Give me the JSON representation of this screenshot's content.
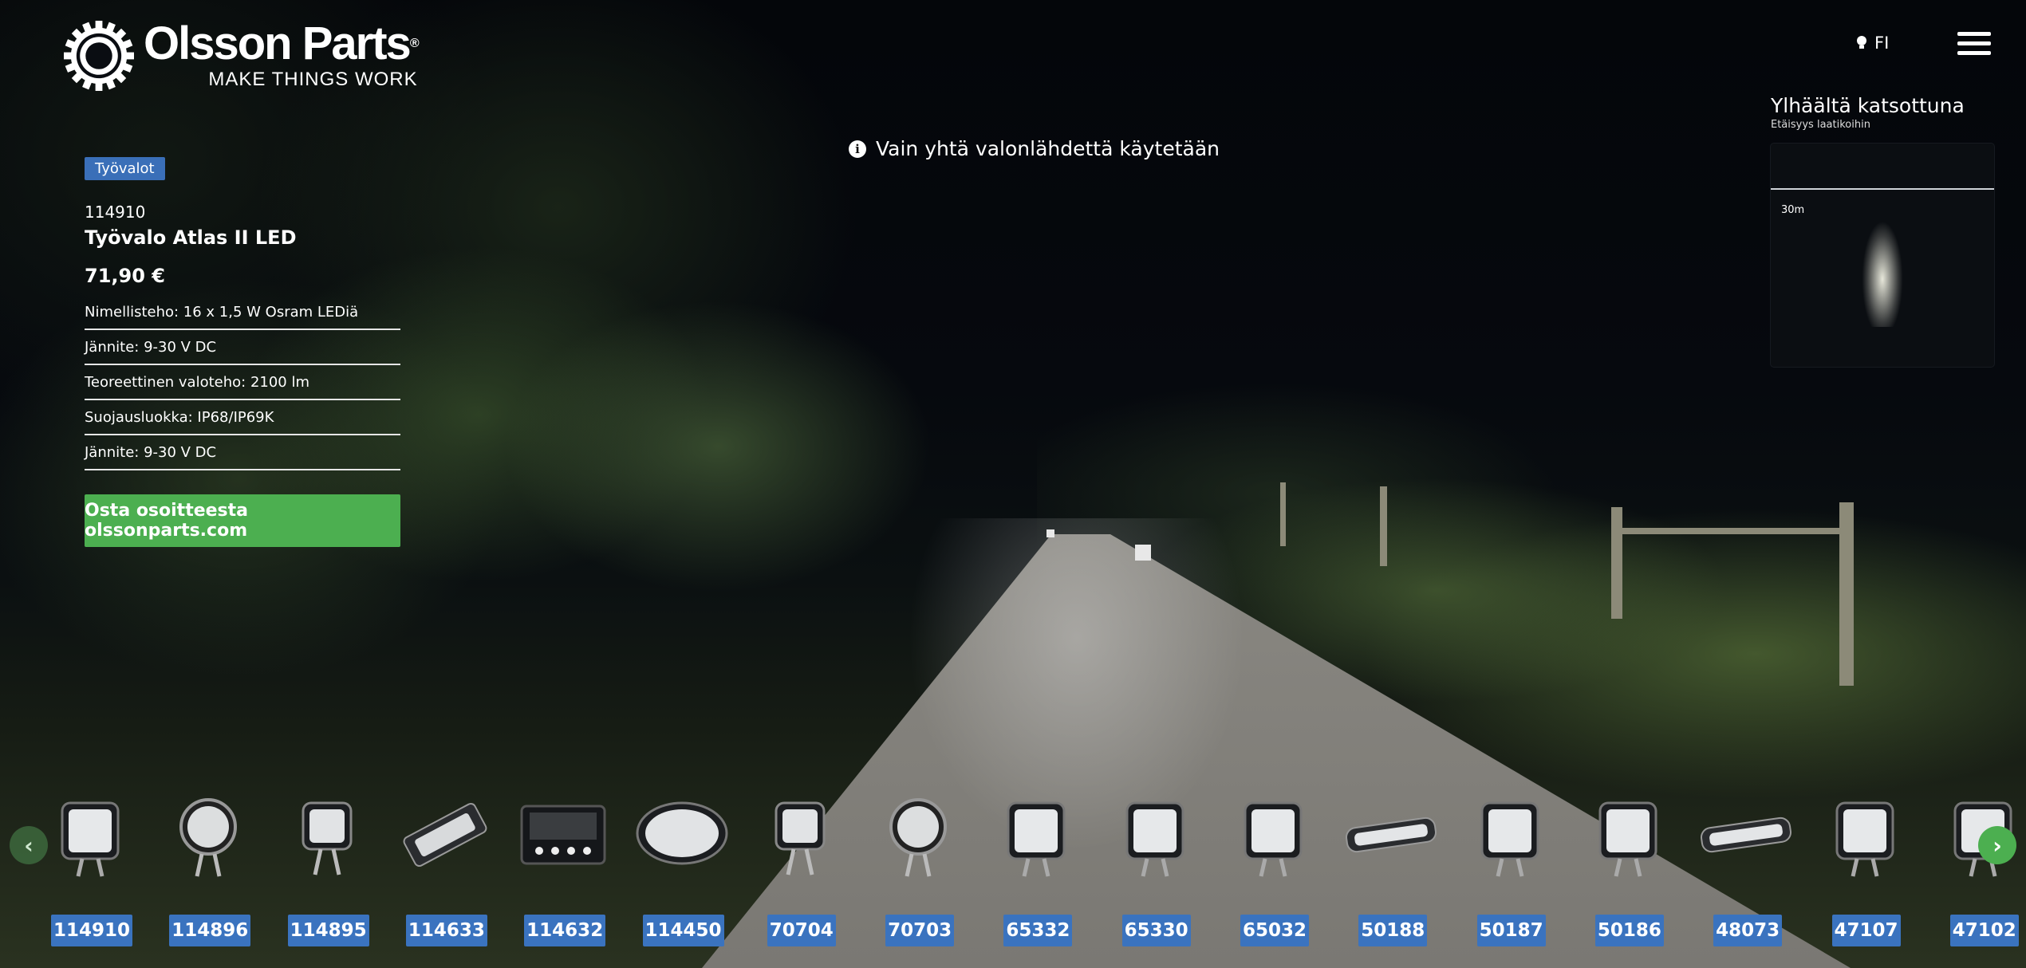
{
  "brand": {
    "name": "Olsson Parts",
    "registered": "®",
    "tagline": "MAKE THINGS WORK",
    "logo_icon": "gear-logo-icon"
  },
  "header": {
    "language": "FI",
    "language_icon": "bulb-icon",
    "menu_icon": "hamburger-icon"
  },
  "notice": {
    "icon": "info-icon",
    "text": "Vain yhtä valonlähdettä käytetään"
  },
  "product": {
    "category": "Työvalot",
    "sku": "114910",
    "name": "Työvalo Atlas II LED",
    "price": "71,90 €",
    "specs": [
      "Nimellisteho: 16 x 1,5 W Osram LEDiä",
      "Jännite: 9-30 V DC",
      "Teoreettinen valoteho: 2100 lm",
      "Suojausluokka: IP68/IP69K",
      "Jännite: 9-30 V DC"
    ],
    "buy_label": "Osta osoitteesta olssonparts.com"
  },
  "topview": {
    "title": "Ylhäältä katsottuna",
    "subtitle": "Etäisyys laatikoihin",
    "distance": "30m"
  },
  "carousel": {
    "prev_icon": "chevron-left-icon",
    "next_icon": "chevron-right-icon",
    "items": [
      {
        "code": "114910",
        "shape": "square"
      },
      {
        "code": "114896",
        "shape": "round"
      },
      {
        "code": "114895",
        "shape": "square-small"
      },
      {
        "code": "114633",
        "shape": "bar-tilted"
      },
      {
        "code": "114632",
        "shape": "rect"
      },
      {
        "code": "114450",
        "shape": "oval"
      },
      {
        "code": "70704",
        "shape": "square-small"
      },
      {
        "code": "70703",
        "shape": "round"
      },
      {
        "code": "65332",
        "shape": "square"
      },
      {
        "code": "65330",
        "shape": "square"
      },
      {
        "code": "65032",
        "shape": "square"
      },
      {
        "code": "50188",
        "shape": "bar"
      },
      {
        "code": "50187",
        "shape": "square"
      },
      {
        "code": "50186",
        "shape": "square"
      },
      {
        "code": "48073",
        "shape": "bar"
      },
      {
        "code": "47107",
        "shape": "square"
      },
      {
        "code": "47102",
        "shape": "square"
      }
    ]
  }
}
